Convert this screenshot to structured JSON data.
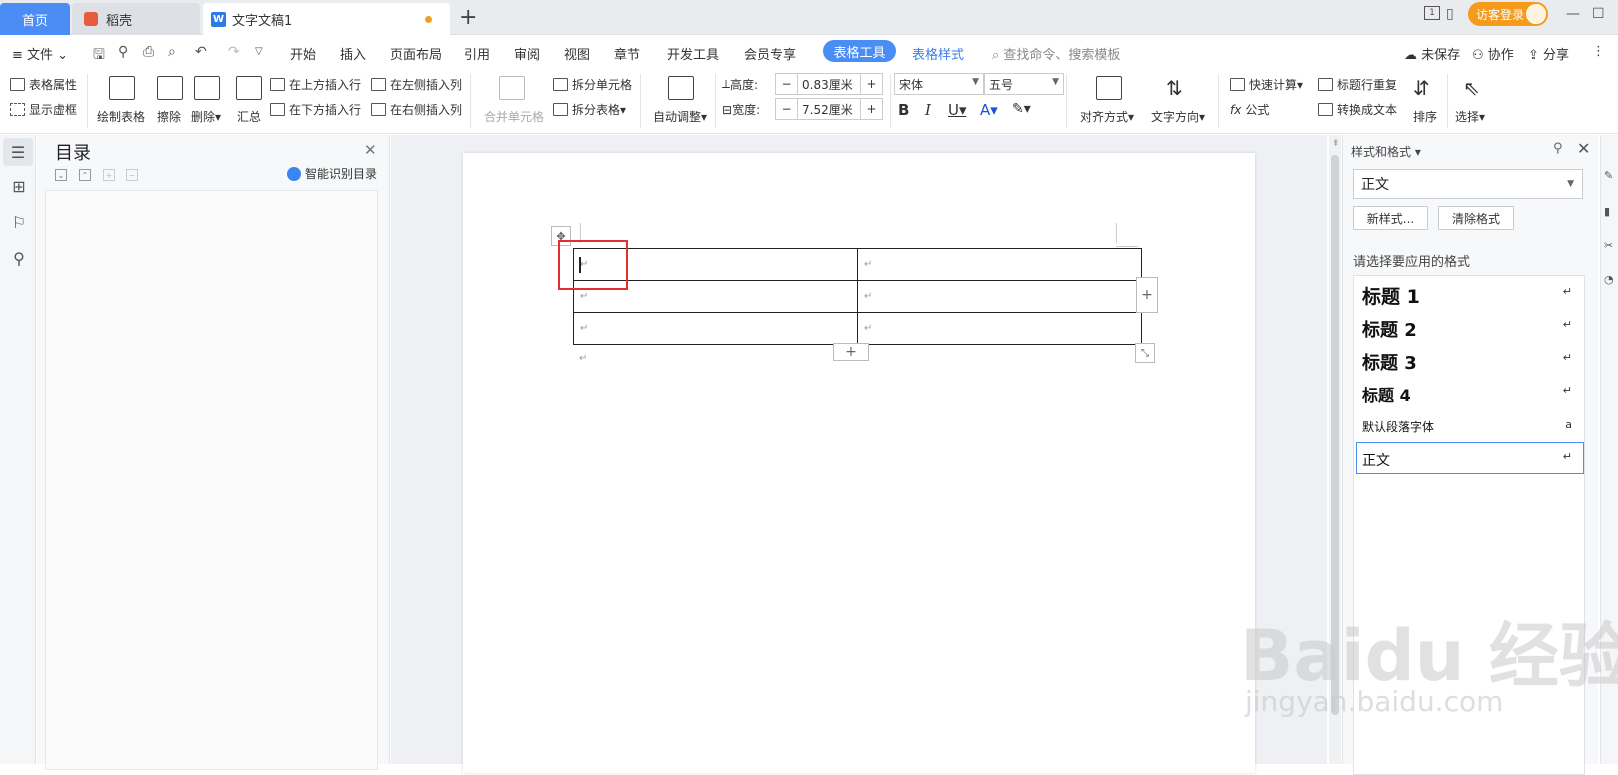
{
  "tabs": {
    "home": "首页",
    "docer": "稻壳",
    "document": "文字文稿1",
    "login": "访客登录"
  },
  "menu": {
    "file": "文件",
    "items": [
      "开始",
      "插入",
      "页面布局",
      "引用",
      "审阅",
      "视图",
      "章节",
      "开发工具",
      "会员专享"
    ],
    "active": "表格工具",
    "table_style": "表格样式",
    "search": "查找命令、搜索模板",
    "unsaved": "未保存",
    "collab": "协作",
    "share": "分享"
  },
  "ribbon": {
    "table_props": "表格属性",
    "show_grid": "显示虚框",
    "draw_table": "绘制表格",
    "erase": "擦除",
    "delete": "删除",
    "summary": "汇总",
    "insert_above": "在上方插入行",
    "insert_below": "在下方插入行",
    "insert_left": "在左侧插入列",
    "insert_right": "在右侧插入列",
    "merge": "合并单元格",
    "split_cell": "拆分单元格",
    "split_table": "拆分表格",
    "autofit": "自动调整",
    "height_label": "高度:",
    "height_value": "0.83厘米",
    "width_label": "宽度:",
    "width_value": "7.52厘米",
    "font": "宋体",
    "font_size": "五号",
    "align": "对齐方式",
    "text_dir": "文字方向",
    "quick_calc": "快速计算",
    "formula": "公式",
    "header_repeat": "标题行重复",
    "to_text": "转换成文本",
    "sort": "排序",
    "select": "选择"
  },
  "toc": {
    "title": "目录",
    "ai": "智能识别目录"
  },
  "styles_panel": {
    "title": "样式和格式",
    "current": "正文",
    "new_style": "新样式...",
    "clear": "清除格式",
    "prompt": "请选择要应用的格式",
    "items": [
      "标题 1",
      "标题 2",
      "标题 3",
      "标题 4",
      "默认段落字体",
      "正文"
    ]
  },
  "watermark": {
    "brand": "Baidu 经验",
    "url": "jingyan.baidu.com"
  },
  "table": {
    "rows": 3,
    "cols": 2
  }
}
